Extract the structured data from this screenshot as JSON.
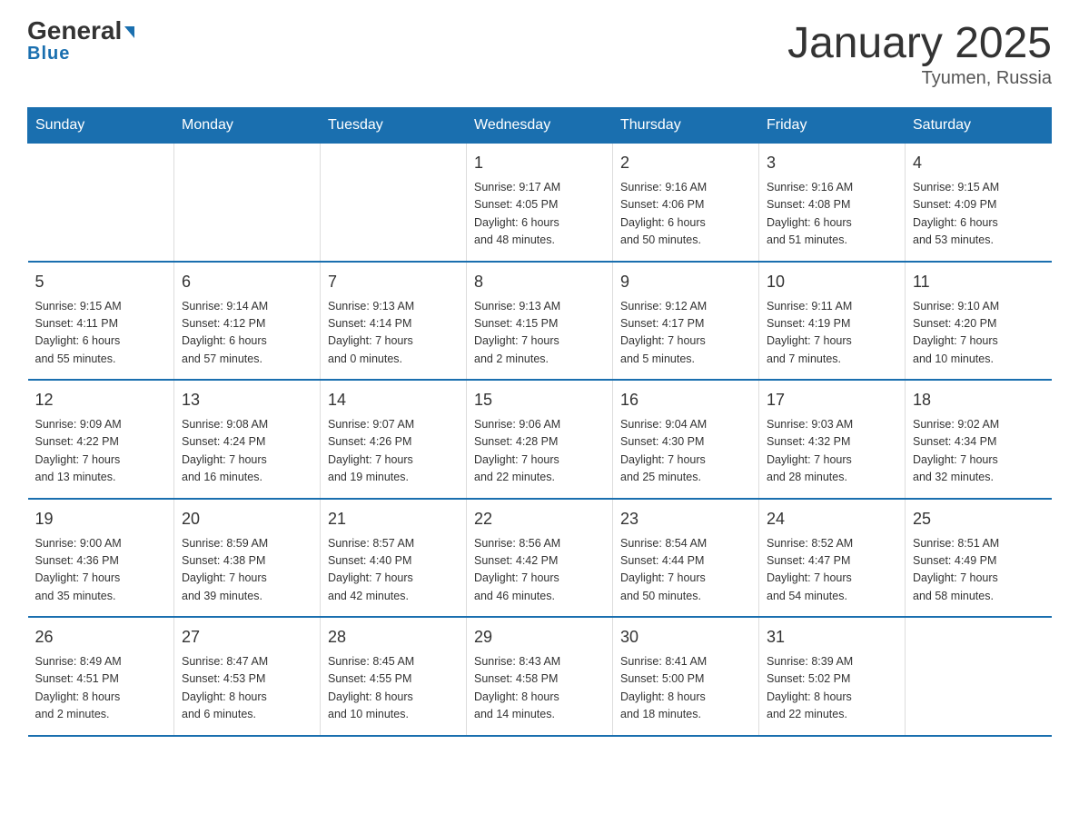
{
  "logo": {
    "name": "General",
    "name2": "Blue"
  },
  "title": "January 2025",
  "subtitle": "Tyumen, Russia",
  "days_of_week": [
    "Sunday",
    "Monday",
    "Tuesday",
    "Wednesday",
    "Thursday",
    "Friday",
    "Saturday"
  ],
  "weeks": [
    [
      {
        "day": "",
        "info": ""
      },
      {
        "day": "",
        "info": ""
      },
      {
        "day": "",
        "info": ""
      },
      {
        "day": "1",
        "info": "Sunrise: 9:17 AM\nSunset: 4:05 PM\nDaylight: 6 hours\nand 48 minutes."
      },
      {
        "day": "2",
        "info": "Sunrise: 9:16 AM\nSunset: 4:06 PM\nDaylight: 6 hours\nand 50 minutes."
      },
      {
        "day": "3",
        "info": "Sunrise: 9:16 AM\nSunset: 4:08 PM\nDaylight: 6 hours\nand 51 minutes."
      },
      {
        "day": "4",
        "info": "Sunrise: 9:15 AM\nSunset: 4:09 PM\nDaylight: 6 hours\nand 53 minutes."
      }
    ],
    [
      {
        "day": "5",
        "info": "Sunrise: 9:15 AM\nSunset: 4:11 PM\nDaylight: 6 hours\nand 55 minutes."
      },
      {
        "day": "6",
        "info": "Sunrise: 9:14 AM\nSunset: 4:12 PM\nDaylight: 6 hours\nand 57 minutes."
      },
      {
        "day": "7",
        "info": "Sunrise: 9:13 AM\nSunset: 4:14 PM\nDaylight: 7 hours\nand 0 minutes."
      },
      {
        "day": "8",
        "info": "Sunrise: 9:13 AM\nSunset: 4:15 PM\nDaylight: 7 hours\nand 2 minutes."
      },
      {
        "day": "9",
        "info": "Sunrise: 9:12 AM\nSunset: 4:17 PM\nDaylight: 7 hours\nand 5 minutes."
      },
      {
        "day": "10",
        "info": "Sunrise: 9:11 AM\nSunset: 4:19 PM\nDaylight: 7 hours\nand 7 minutes."
      },
      {
        "day": "11",
        "info": "Sunrise: 9:10 AM\nSunset: 4:20 PM\nDaylight: 7 hours\nand 10 minutes."
      }
    ],
    [
      {
        "day": "12",
        "info": "Sunrise: 9:09 AM\nSunset: 4:22 PM\nDaylight: 7 hours\nand 13 minutes."
      },
      {
        "day": "13",
        "info": "Sunrise: 9:08 AM\nSunset: 4:24 PM\nDaylight: 7 hours\nand 16 minutes."
      },
      {
        "day": "14",
        "info": "Sunrise: 9:07 AM\nSunset: 4:26 PM\nDaylight: 7 hours\nand 19 minutes."
      },
      {
        "day": "15",
        "info": "Sunrise: 9:06 AM\nSunset: 4:28 PM\nDaylight: 7 hours\nand 22 minutes."
      },
      {
        "day": "16",
        "info": "Sunrise: 9:04 AM\nSunset: 4:30 PM\nDaylight: 7 hours\nand 25 minutes."
      },
      {
        "day": "17",
        "info": "Sunrise: 9:03 AM\nSunset: 4:32 PM\nDaylight: 7 hours\nand 28 minutes."
      },
      {
        "day": "18",
        "info": "Sunrise: 9:02 AM\nSunset: 4:34 PM\nDaylight: 7 hours\nand 32 minutes."
      }
    ],
    [
      {
        "day": "19",
        "info": "Sunrise: 9:00 AM\nSunset: 4:36 PM\nDaylight: 7 hours\nand 35 minutes."
      },
      {
        "day": "20",
        "info": "Sunrise: 8:59 AM\nSunset: 4:38 PM\nDaylight: 7 hours\nand 39 minutes."
      },
      {
        "day": "21",
        "info": "Sunrise: 8:57 AM\nSunset: 4:40 PM\nDaylight: 7 hours\nand 42 minutes."
      },
      {
        "day": "22",
        "info": "Sunrise: 8:56 AM\nSunset: 4:42 PM\nDaylight: 7 hours\nand 46 minutes."
      },
      {
        "day": "23",
        "info": "Sunrise: 8:54 AM\nSunset: 4:44 PM\nDaylight: 7 hours\nand 50 minutes."
      },
      {
        "day": "24",
        "info": "Sunrise: 8:52 AM\nSunset: 4:47 PM\nDaylight: 7 hours\nand 54 minutes."
      },
      {
        "day": "25",
        "info": "Sunrise: 8:51 AM\nSunset: 4:49 PM\nDaylight: 7 hours\nand 58 minutes."
      }
    ],
    [
      {
        "day": "26",
        "info": "Sunrise: 8:49 AM\nSunset: 4:51 PM\nDaylight: 8 hours\nand 2 minutes."
      },
      {
        "day": "27",
        "info": "Sunrise: 8:47 AM\nSunset: 4:53 PM\nDaylight: 8 hours\nand 6 minutes."
      },
      {
        "day": "28",
        "info": "Sunrise: 8:45 AM\nSunset: 4:55 PM\nDaylight: 8 hours\nand 10 minutes."
      },
      {
        "day": "29",
        "info": "Sunrise: 8:43 AM\nSunset: 4:58 PM\nDaylight: 8 hours\nand 14 minutes."
      },
      {
        "day": "30",
        "info": "Sunrise: 8:41 AM\nSunset: 5:00 PM\nDaylight: 8 hours\nand 18 minutes."
      },
      {
        "day": "31",
        "info": "Sunrise: 8:39 AM\nSunset: 5:02 PM\nDaylight: 8 hours\nand 22 minutes."
      },
      {
        "day": "",
        "info": ""
      }
    ]
  ]
}
